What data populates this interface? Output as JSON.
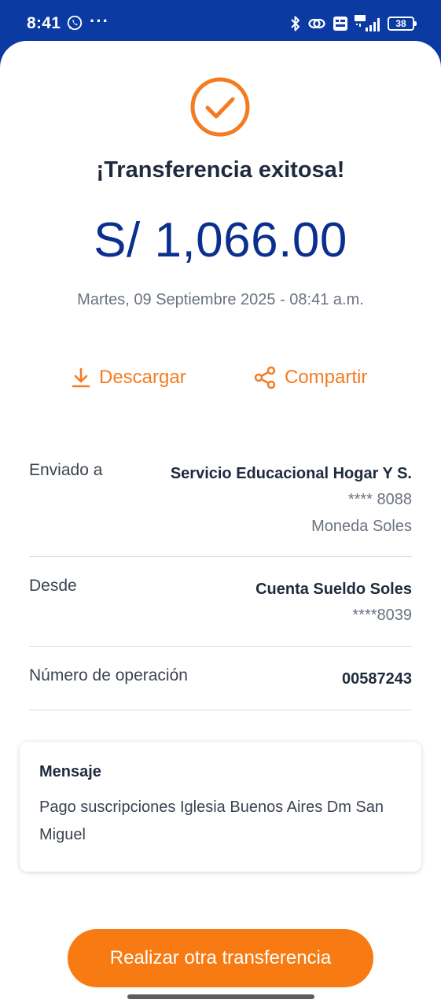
{
  "status_bar": {
    "time": "8:41",
    "menu_dots": "···",
    "battery": "38",
    "icons": [
      "whatsapp-icon",
      "bluetooth-icon",
      "link-icon",
      "volte-icon",
      "signal-4g-icon",
      "battery-icon"
    ]
  },
  "colors": {
    "brand_blue": "#0b3aa3",
    "accent_orange": "#f47b20",
    "amount_blue": "#0b2f8f"
  },
  "receipt": {
    "title": "¡Transferencia exitosa!",
    "amount": "S/ 1,066.00",
    "datetime": "Martes, 09 Septiembre 2025 - 08:41 a.m."
  },
  "actions": {
    "download_label": "Descargar",
    "share_label": "Compartir"
  },
  "details": {
    "sent_to": {
      "label": "Enviado a",
      "name": "Servicio Educacional Hogar Y S.",
      "account": "**** 8088",
      "currency": "Moneda Soles"
    },
    "from": {
      "label": "Desde",
      "name": "Cuenta Sueldo Soles",
      "account": "****8039"
    },
    "operation": {
      "label": "Número de operación",
      "value": "00587243"
    }
  },
  "message": {
    "title": "Mensaje",
    "text": "Pago suscripciones Iglesia Buenos Aires Dm San Miguel"
  },
  "primary_button": {
    "label": "Realizar otra transferencia"
  }
}
